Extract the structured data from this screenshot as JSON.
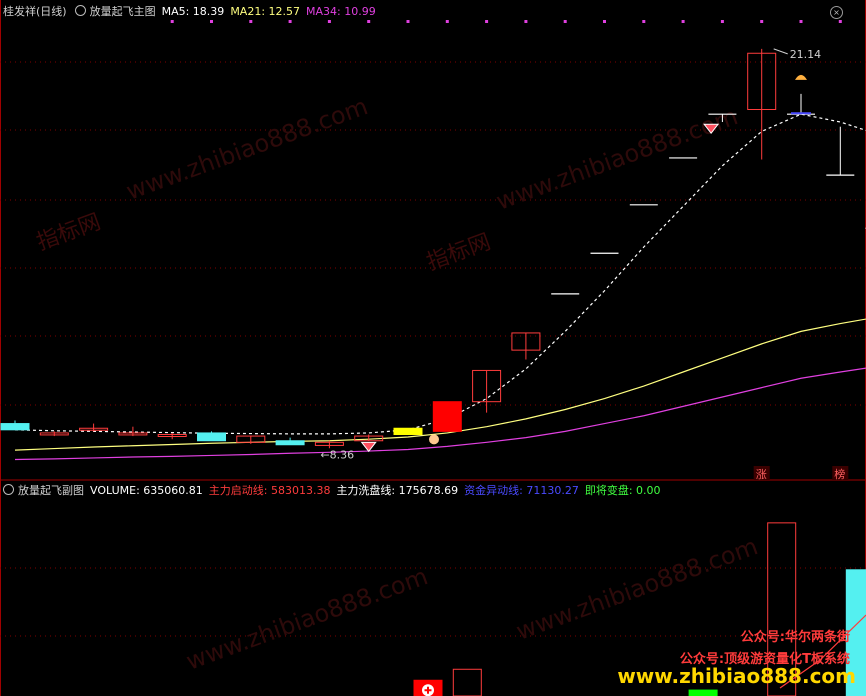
{
  "main": {
    "stock": "桂发祥(日线)",
    "indicator": "放量起飞主图",
    "ma5_label": "MA5: 18.39",
    "ma21_label": "MA21: 12.57",
    "ma34_label": "MA34: 10.99",
    "high_label": "21.14",
    "low_label": "8.36",
    "badge_zhang": "涨",
    "badge_bang": "榜"
  },
  "sub": {
    "indicator": "放量起飞副图",
    "volume_label": "VOLUME: 635060.81",
    "main_start_label": "主力启动线: 583013.38",
    "main_wash_label": "主力洗盘线: 175678.69",
    "fund_label": "资金异动线: 71130.27",
    "change_label": "即将变盘: 0.00"
  },
  "watermark": {
    "brand": "指标网",
    "site": "www.zhibiao888.com",
    "promo1": "公众号:华尔两条街",
    "promo2": "公众号:顶级游资量化T板系统",
    "promo3": "www.zhibiao888.com"
  },
  "colors": {
    "bg": "#000000",
    "up": "#ff3c3c",
    "down": "#54f0f0",
    "limit": "#ff0000",
    "doji_yellow": "#ffff00",
    "ma5": "#ffffff",
    "ma21": "#ffff80",
    "ma34": "#e040e0",
    "grid": "#800000"
  },
  "chart_data": [
    {
      "type": "candlestick",
      "title": "放量起飞主图",
      "ylim": [
        7.6,
        22.0
      ],
      "candles": [
        {
          "o": 9.15,
          "h": 9.25,
          "l": 9.0,
          "c": 8.95,
          "style": "down"
        },
        {
          "o": 8.85,
          "h": 8.9,
          "l": 8.75,
          "c": 8.8,
          "style": "up"
        },
        {
          "o": 9.0,
          "h": 9.15,
          "l": 8.9,
          "c": 8.98,
          "style": "doji"
        },
        {
          "o": 8.85,
          "h": 9.05,
          "l": 8.75,
          "c": 8.85,
          "style": "doji"
        },
        {
          "o": 8.8,
          "h": 8.85,
          "l": 8.65,
          "c": 8.75,
          "style": "doji"
        },
        {
          "o": 8.85,
          "h": 8.9,
          "l": 8.6,
          "c": 8.6,
          "style": "down"
        },
        {
          "o": 8.55,
          "h": 8.75,
          "l": 8.5,
          "c": 8.75,
          "style": "up"
        },
        {
          "o": 8.6,
          "h": 8.7,
          "l": 8.55,
          "c": 8.6,
          "style": "down"
        },
        {
          "o": 8.55,
          "h": 8.6,
          "l": 8.36,
          "c": 8.45,
          "style": "up"
        },
        {
          "o": 8.6,
          "h": 8.8,
          "l": 8.6,
          "c": 8.75,
          "style": "up"
        },
        {
          "o": 8.8,
          "h": 9.0,
          "l": 8.8,
          "c": 9.0,
          "style": "yellow"
        },
        {
          "o": 8.9,
          "h": 9.85,
          "l": 8.9,
          "c": 9.85,
          "style": "limit"
        },
        {
          "o": 9.85,
          "h": 10.85,
          "l": 9.5,
          "c": 10.85,
          "style": "up"
        },
        {
          "o": 11.5,
          "h": 12.05,
          "l": 11.2,
          "c": 12.05,
          "style": "up"
        },
        {
          "o": 13.3,
          "h": 13.3,
          "l": 13.3,
          "c": 13.3,
          "style": "flat"
        },
        {
          "o": 14.6,
          "h": 14.6,
          "l": 14.6,
          "c": 14.6,
          "style": "flat"
        },
        {
          "o": 16.15,
          "h": 16.15,
          "l": 16.15,
          "c": 16.15,
          "style": "flat"
        },
        {
          "o": 17.65,
          "h": 17.65,
          "l": 17.65,
          "c": 17.65,
          "style": "flat"
        },
        {
          "o": 18.8,
          "h": 19.05,
          "l": 18.8,
          "c": 19.05,
          "style": "flat"
        },
        {
          "o": 19.2,
          "h": 21.14,
          "l": 17.6,
          "c": 21.0,
          "style": "up"
        },
        {
          "o": 19.05,
          "h": 19.7,
          "l": 19.05,
          "c": 19.05,
          "style": "flat"
        },
        {
          "o": 17.1,
          "h": 18.65,
          "l": 17.1,
          "c": 17.1,
          "style": "flat"
        },
        {
          "o": 15.4,
          "h": 16.9,
          "l": 15.4,
          "c": 15.4,
          "style": "flat"
        }
      ],
      "ma5": [
        8.95,
        8.92,
        8.9,
        8.88,
        8.86,
        8.84,
        8.83,
        8.82,
        8.82,
        8.85,
        8.95,
        9.3,
        9.95,
        10.9,
        12.1,
        13.4,
        14.8,
        16.1,
        17.4,
        18.5,
        19.05,
        18.8,
        18.39
      ],
      "ma21": [
        8.3,
        8.35,
        8.4,
        8.44,
        8.48,
        8.52,
        8.55,
        8.58,
        8.6,
        8.65,
        8.72,
        8.85,
        9.05,
        9.3,
        9.6,
        9.95,
        10.35,
        10.8,
        11.25,
        11.7,
        12.1,
        12.35,
        12.57
      ],
      "ma34": [
        8.0,
        8.02,
        8.05,
        8.08,
        8.1,
        8.13,
        8.16,
        8.2,
        8.23,
        8.27,
        8.32,
        8.42,
        8.55,
        8.7,
        8.9,
        9.15,
        9.4,
        9.7,
        10.0,
        10.3,
        10.6,
        10.8,
        10.99
      ]
    },
    {
      "type": "bar",
      "title": "放量起飞副图",
      "bars": [
        {
          "i": 10,
          "value": 53000,
          "style": "limit"
        },
        {
          "i": 11,
          "value": 90000,
          "style": "outline"
        },
        {
          "i": 17,
          "value": 20000,
          "style": "green"
        },
        {
          "i": 19,
          "value": 583013,
          "style": "outline"
        },
        {
          "i": 21,
          "value": 425000,
          "style": "cyan"
        },
        {
          "i": 22,
          "value": 340000,
          "style": "cyan"
        }
      ],
      "ylim": [
        0,
        660000
      ]
    }
  ]
}
